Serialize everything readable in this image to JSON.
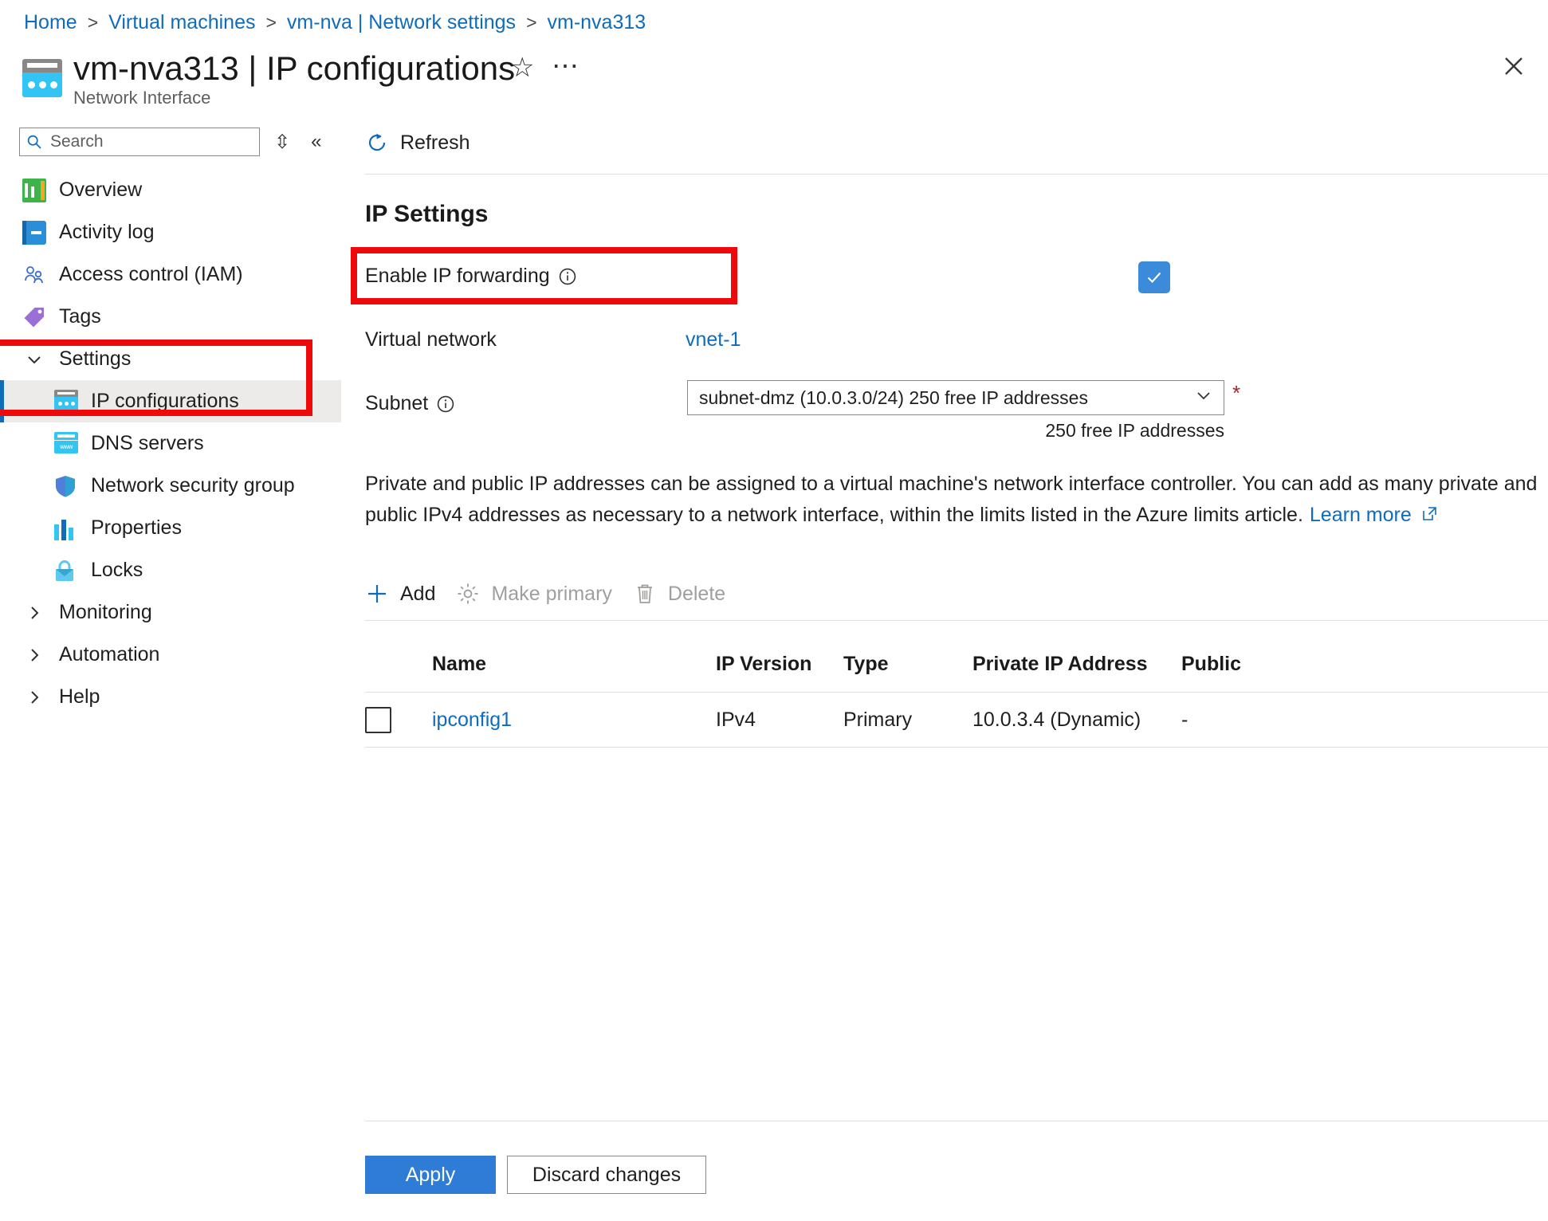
{
  "breadcrumb": {
    "items": [
      {
        "label": "Home"
      },
      {
        "label": "Virtual machines"
      },
      {
        "label": "vm-nva | Network settings"
      },
      {
        "label": "vm-nva313"
      }
    ],
    "separator": ">"
  },
  "header": {
    "title": "vm-nva313 | IP configurations",
    "subtitle": "Network Interface",
    "favorite_icon": "star-icon",
    "more_icon": "ellipsis-icon",
    "close_icon": "close-icon",
    "resource_icon": "network-interface-icon"
  },
  "sidebar": {
    "search": {
      "placeholder": "Search",
      "value": "",
      "icon": "search-icon"
    },
    "sort_icon": "sort-icon",
    "collapse_icon": "collapse-icon",
    "items": [
      {
        "label": "Overview",
        "icon": "overview-icon",
        "kind": "item"
      },
      {
        "label": "Activity log",
        "icon": "activity-log-icon",
        "kind": "item"
      },
      {
        "label": "Access control (IAM)",
        "icon": "access-control-icon",
        "kind": "item"
      },
      {
        "label": "Tags",
        "icon": "tags-icon",
        "kind": "item"
      },
      {
        "label": "Settings",
        "icon": "chevron-down-icon",
        "kind": "group-expanded"
      },
      {
        "label": "IP configurations",
        "icon": "ip-configurations-icon",
        "kind": "child",
        "selected": true
      },
      {
        "label": "DNS servers",
        "icon": "dns-servers-icon",
        "kind": "child"
      },
      {
        "label": "Network security group",
        "icon": "shield-icon",
        "kind": "child"
      },
      {
        "label": "Properties",
        "icon": "properties-icon",
        "kind": "child"
      },
      {
        "label": "Locks",
        "icon": "lock-icon",
        "kind": "child"
      },
      {
        "label": "Monitoring",
        "icon": "chevron-right-icon",
        "kind": "group-collapsed"
      },
      {
        "label": "Automation",
        "icon": "chevron-right-icon",
        "kind": "group-collapsed"
      },
      {
        "label": "Help",
        "icon": "chevron-right-icon",
        "kind": "group-collapsed"
      }
    ]
  },
  "toolbar": {
    "refresh_label": "Refresh",
    "refresh_icon": "refresh-icon"
  },
  "ip_settings": {
    "heading": "IP Settings",
    "enable_ip_forwarding": {
      "label": "Enable IP forwarding",
      "info_icon": "info-icon",
      "checked": true
    },
    "virtual_network": {
      "label": "Virtual network",
      "value": "vnet-1"
    },
    "subnet": {
      "label": "Subnet",
      "info_icon": "info-icon",
      "selected": "subnet-dmz (10.0.3.0/24) 250 free IP addresses",
      "options": [
        "subnet-dmz (10.0.3.0/24) 250 free IP addresses"
      ],
      "required_marker": "*",
      "hint": "250 free IP addresses",
      "caret_icon": "chevron-down-icon"
    },
    "description": "Private and public IP addresses can be assigned to a virtual machine's network interface controller. You can add as many private and public IPv4 addresses as necessary to a network interface, within the limits listed in the Azure limits article.",
    "learn_more_label": "Learn more",
    "learn_more_icon": "external-link-icon"
  },
  "list_commands": [
    {
      "label": "Add",
      "icon": "plus-icon",
      "disabled": false
    },
    {
      "label": "Make primary",
      "icon": "gear-icon",
      "disabled": true
    },
    {
      "label": "Delete",
      "icon": "trash-icon",
      "disabled": true
    }
  ],
  "table": {
    "columns": [
      "Name",
      "IP Version",
      "Type",
      "Private IP Address",
      "Public"
    ],
    "rows": [
      {
        "checked": false,
        "name": "ipconfig1",
        "ip_version": "IPv4",
        "type": "Primary",
        "private_ip": "10.0.3.4 (Dynamic)",
        "public_ip": "-"
      }
    ]
  },
  "footer": {
    "apply_label": "Apply",
    "discard_label": "Discard changes"
  },
  "annotations": {
    "highlight_color": "#ee0a0a",
    "boxes": [
      "enable-ip-forwarding-row",
      "sidebar-settings-ip-configurations"
    ]
  },
  "colors": {
    "link": "#0f6cbd",
    "primary_button": "#2e7cd6",
    "checkbox_checked": "#3c8ada",
    "selected_nav": "#edebe9",
    "accent_bar": "#0f6cbd"
  }
}
